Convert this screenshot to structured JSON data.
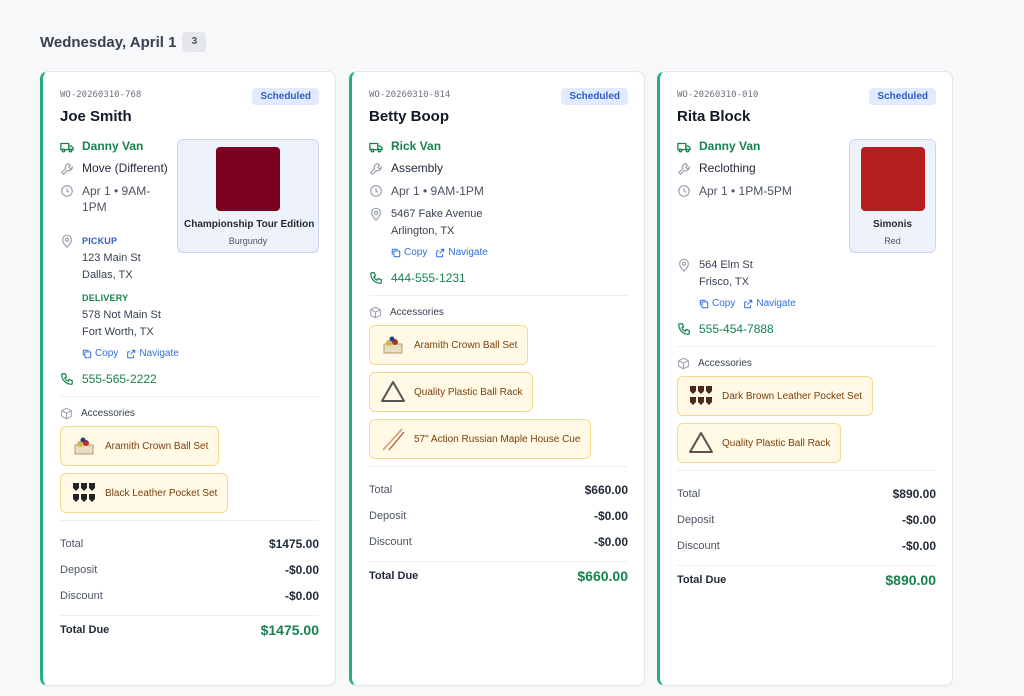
{
  "day": {
    "title": "Wednesday, April 1",
    "count": "3"
  },
  "colors": {
    "accent": "#22b07d",
    "green": "#16834f",
    "blue": "#2f5cc7",
    "burgundy": "#7b0022",
    "red": "#b42020"
  },
  "orders": [
    {
      "wo": "WO-20260310-768",
      "status": "Scheduled",
      "customer": "Joe Smith",
      "van": "Danny Van",
      "service": "Move (Different)",
      "date": "Apr 1 • 9AM-1PM",
      "product": {
        "name": "Championship Tour Edition",
        "color": "Burgundy",
        "swatch": "#7b0022"
      },
      "pickup_label": "PICKUP",
      "pickup_line1": "123 Main St",
      "pickup_line2": "Dallas, TX",
      "delivery_label": "DELIVERY",
      "delivery_line1": "578 Not Main St",
      "delivery_line2": "Fort Worth, TX",
      "copy": "Copy",
      "navigate": "Navigate",
      "phone": "555-565-2222",
      "accessories_label": "Accessories",
      "accessories": [
        {
          "name": "Aramith Crown Ball Set",
          "icon": "ball-set-icon"
        },
        {
          "name": "Black Leather Pocket Set",
          "icon": "pocket-set-icon"
        }
      ],
      "total_label": "Total",
      "total": "$1475.00",
      "deposit_label": "Deposit",
      "deposit": "-$0.00",
      "discount_label": "Discount",
      "discount": "-$0.00",
      "due_label": "Total Due",
      "due": "$1475.00"
    },
    {
      "wo": "WO-20260310-814",
      "status": "Scheduled",
      "customer": "Betty Boop",
      "van": "Rick Van",
      "service": "Assembly",
      "date": "Apr 1 • 9AM-1PM",
      "address_line1": "5467 Fake Avenue",
      "address_line2": "Arlington, TX",
      "copy": "Copy",
      "navigate": "Navigate",
      "phone": "444-555-1231",
      "accessories_label": "Accessories",
      "accessories": [
        {
          "name": "Aramith Crown Ball Set",
          "icon": "ball-set-icon"
        },
        {
          "name": "Quality Plastic Ball Rack",
          "icon": "ball-rack-icon"
        },
        {
          "name": "57\" Action Russian Maple House Cue",
          "icon": "cue-icon"
        }
      ],
      "total_label": "Total",
      "total": "$660.00",
      "deposit_label": "Deposit",
      "deposit": "-$0.00",
      "discount_label": "Discount",
      "discount": "-$0.00",
      "due_label": "Total Due",
      "due": "$660.00"
    },
    {
      "wo": "WO-20260310-010",
      "status": "Scheduled",
      "customer": "Rita Block",
      "van": "Danny Van",
      "service": "Reclothing",
      "date": "Apr 1 • 1PM-5PM",
      "product": {
        "name": "Simonis",
        "color": "Red",
        "swatch": "#b42020"
      },
      "address_line1": "564 Elm St",
      "address_line2": "Frisco, TX",
      "copy": "Copy",
      "navigate": "Navigate",
      "phone": "555-454-7888",
      "accessories_label": "Accessories",
      "accessories": [
        {
          "name": "Dark Brown Leather Pocket Set",
          "icon": "pocket-set-icon"
        },
        {
          "name": "Quality Plastic Ball Rack",
          "icon": "ball-rack-icon"
        }
      ],
      "total_label": "Total",
      "total": "$890.00",
      "deposit_label": "Deposit",
      "deposit": "-$0.00",
      "discount_label": "Discount",
      "discount": "-$0.00",
      "due_label": "Total Due",
      "due": "$890.00"
    }
  ]
}
